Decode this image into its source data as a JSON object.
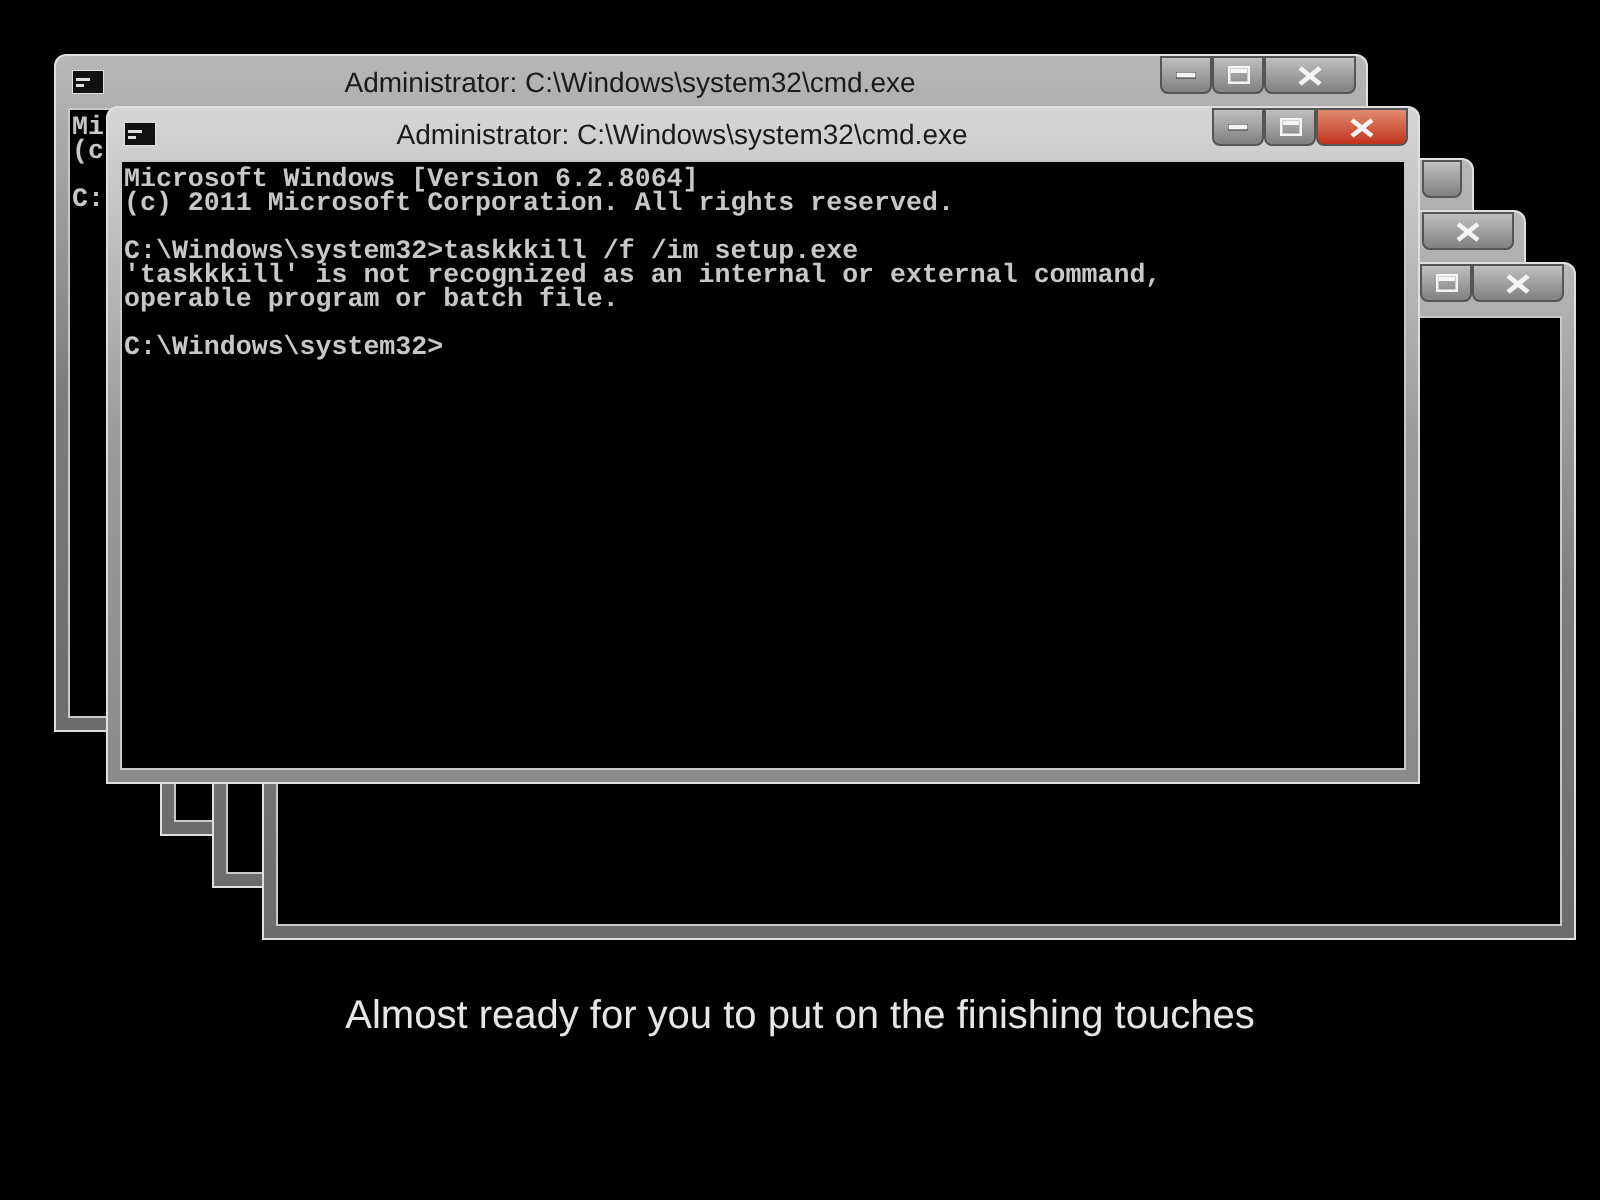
{
  "windows": [
    {
      "title": "Administrator: C:\\Windows\\system32\\cmd.exe",
      "active": false,
      "buttons": [
        {
          "kind": "minimize"
        },
        {
          "kind": "maximize"
        },
        {
          "kind": "close"
        }
      ],
      "console": [
        [
          "Mi",
          "(c"
        ],
        [
          "C:"
        ]
      ]
    },
    {
      "active": false,
      "buttons": [
        {
          "kind": "blank"
        }
      ]
    },
    {
      "active": false,
      "buttons": [
        {
          "kind": "close"
        }
      ]
    },
    {
      "active": false,
      "buttons": [
        {
          "kind": "maximize"
        },
        {
          "kind": "close"
        }
      ]
    },
    {
      "title": "Administrator: C:\\Windows\\system32\\cmd.exe",
      "active": true,
      "buttons": [
        {
          "kind": "minimize"
        },
        {
          "kind": "maximize"
        },
        {
          "kind": "close"
        }
      ],
      "console": [
        [
          "Microsoft Windows [Version 6.2.8064]",
          "(c) 2011 Microsoft Corporation. All rights reserved."
        ],
        [
          "C:\\Windows\\system32>taskkkill /f /im setup.exe",
          "'taskkkill' is not recognized as an internal or external command,",
          "operable program or batch file."
        ],
        [
          "C:\\Windows\\system32>"
        ]
      ]
    }
  ],
  "caption": "Almost ready for you to put on the finishing touches"
}
